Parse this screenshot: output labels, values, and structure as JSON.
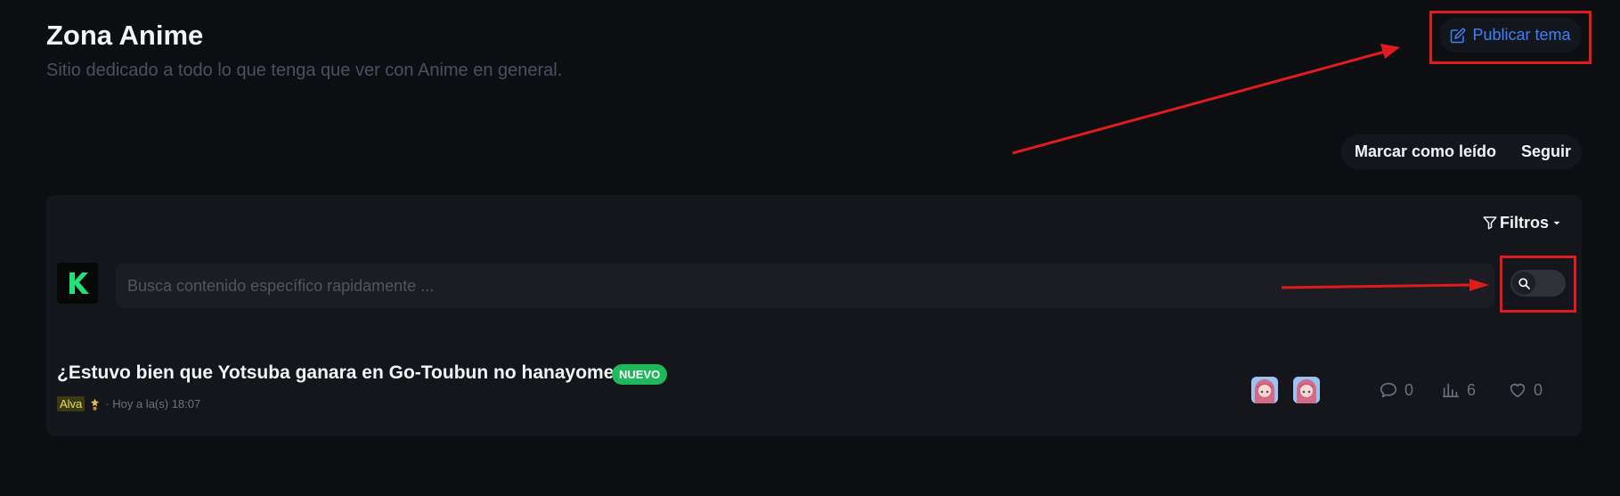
{
  "header": {
    "title": "Zona Anime",
    "subtitle": "Sitio dedicado a todo lo que tenga que ver con Anime en general.",
    "publish_label": "Publicar tema"
  },
  "actions": {
    "mark_read": "Marcar como leído",
    "follow": "Seguir"
  },
  "toolbar": {
    "filters_label": "Filtros"
  },
  "search": {
    "placeholder": "Busca contenido específico rapidamente ..."
  },
  "topic": {
    "title": "¿Estuvo bien que Yotsuba ganara en Go-Toubun no hanayome?",
    "badge": "NUEVO",
    "author": "Alva",
    "time": "· Hoy a la(s) 18:07",
    "replies": "0",
    "views": "6",
    "likes": "0"
  },
  "colors": {
    "accent": "#3b82f6",
    "badge": "#1fb85a",
    "annotation": "#e01b1b",
    "background": "#0d0e12",
    "panel": "#15161b"
  },
  "icons": {
    "publish": "edit-icon",
    "filters": "filter-icon",
    "search": "search-icon",
    "replies": "comment-icon",
    "views": "bar-chart-icon",
    "likes": "heart-icon"
  }
}
